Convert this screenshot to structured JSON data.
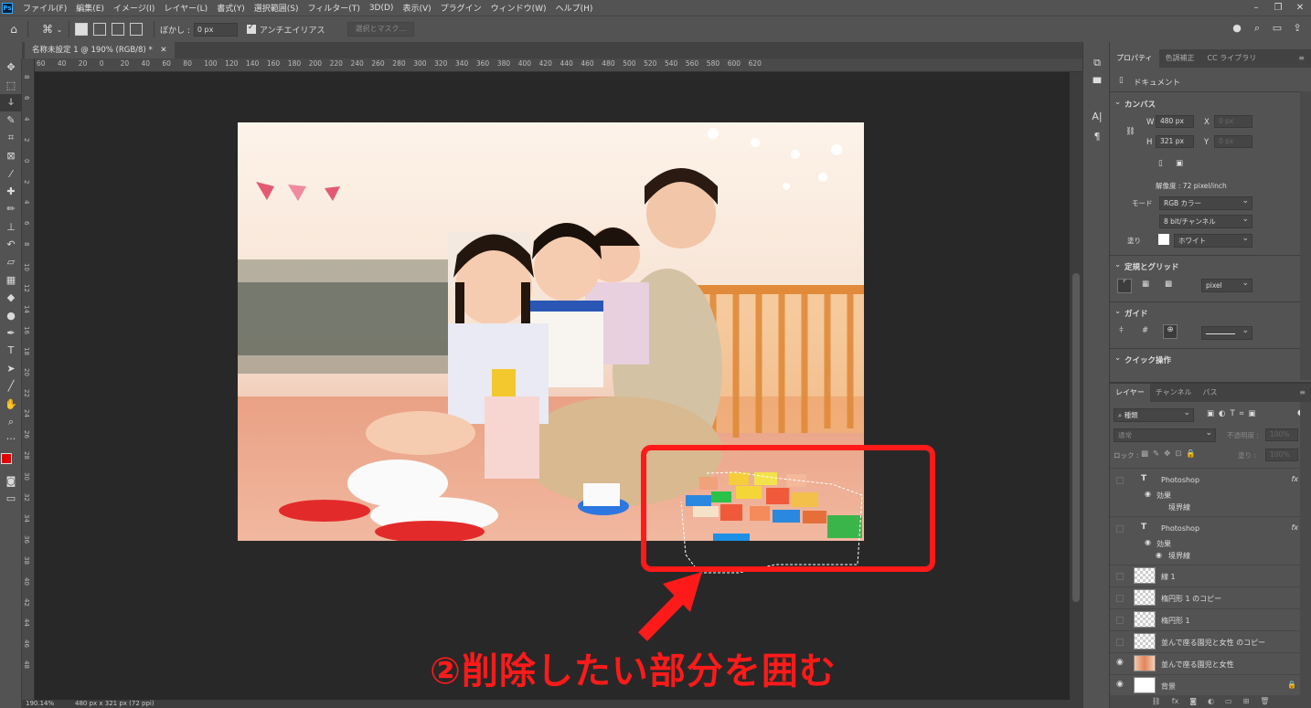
{
  "app": {
    "logo": "Ps",
    "menu": [
      "ファイル(F)",
      "編集(E)",
      "イメージ(I)",
      "レイヤー(L)",
      "書式(Y)",
      "選択範囲(S)",
      "フィルター(T)",
      "3D(D)",
      "表示(V)",
      "プラグイン",
      "ウィンドウ(W)",
      "ヘルプ(H)"
    ]
  },
  "options": {
    "feather_label": "ぼかし :",
    "feather_value": "0 px",
    "antialias_label": "アンチエイリアス",
    "select_mask_label": "選択とマスク..."
  },
  "document": {
    "tab_title": "名称未設定 1 @ 190% (RGB/8) *",
    "zoom_status": "190.14%",
    "size_status": "480 px x 321 px (72 ppi)"
  },
  "ruler": {
    "h_ticks": [
      "60",
      "40",
      "20",
      "0",
      "20",
      "40",
      "60",
      "80",
      "100",
      "120",
      "140",
      "160",
      "180",
      "200",
      "220",
      "240",
      "260",
      "280",
      "300",
      "320",
      "340",
      "360",
      "380",
      "400",
      "420",
      "440",
      "460",
      "480",
      "500",
      "520",
      "540",
      "560",
      "580",
      "600",
      "620"
    ],
    "v_ticks": [
      "8",
      "6",
      "4",
      "2",
      "0",
      "2",
      "4",
      "6",
      "8",
      "10",
      "12",
      "14",
      "16",
      "18",
      "20",
      "22",
      "24",
      "26",
      "28",
      "30",
      "32",
      "34",
      "36",
      "38",
      "40",
      "42",
      "44",
      "46",
      "48"
    ]
  },
  "annotation": {
    "text": "②削除したい部分を囲む",
    "color": "#ff1a1a"
  },
  "properties": {
    "tabs": [
      "プロパティ",
      "色調補正",
      "CC ライブラリ"
    ],
    "doc_label": "ドキュメント",
    "canvas_title": "カンバス",
    "w_label": "W",
    "w_value": "480 px",
    "x_label": "X",
    "x_value": "0 px",
    "h_label": "H",
    "h_value": "321 px",
    "y_label": "Y",
    "y_value": "0 px",
    "resolution": "解像度 : 72 pixel/inch",
    "mode_label": "モード",
    "mode_value": "RGB カラー",
    "bit_value": "8 bit/チャンネル",
    "fill_label": "塗り",
    "fill_value": "ホワイト",
    "grid_title": "定規とグリッド",
    "grid_unit": "pixel",
    "guide_title": "ガイド",
    "quick_title": "クイック操作"
  },
  "layers": {
    "tabs": [
      "レイヤー",
      "チャンネル",
      "パス"
    ],
    "filter_label": "種類",
    "blend_mode": "通常",
    "opacity_label": "不透明度 :",
    "opacity_value": "100%",
    "lock_label": "ロック :",
    "fill_label": "塗り :",
    "fill_value": "100%",
    "effects_label": "効果",
    "stroke_label": "境界線",
    "fx": "fx",
    "items": [
      {
        "name": "Photoshop",
        "kind": "text"
      },
      {
        "name": "Photoshop",
        "kind": "text"
      },
      {
        "name": "線 1",
        "kind": "shape"
      },
      {
        "name": "楕円形 1 のコピー",
        "kind": "shape"
      },
      {
        "name": "楕円形 1",
        "kind": "shape"
      },
      {
        "name": "並んで座る園児と女性 のコピー",
        "kind": "image"
      },
      {
        "name": "並んで座る園児と女性",
        "kind": "image"
      },
      {
        "name": "背景",
        "kind": "bg"
      }
    ]
  }
}
